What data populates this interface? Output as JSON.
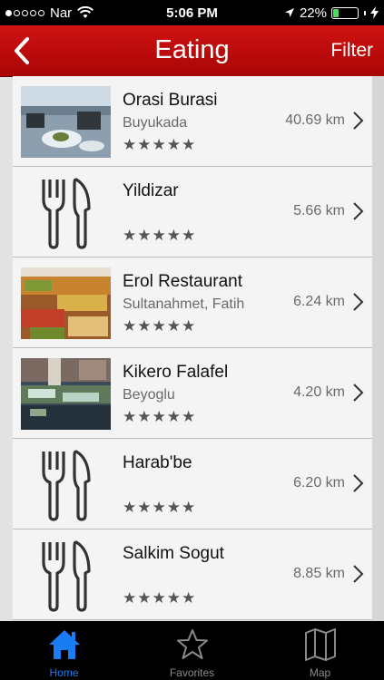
{
  "status_bar": {
    "carrier": "Nar",
    "time": "5:06 PM",
    "battery": "22%",
    "battery_level": 0.22
  },
  "nav": {
    "title": "Eating",
    "filter_label": "Filter",
    "back_icon": "chevron-left-icon"
  },
  "restaurants": [
    {
      "name": "Orasi Burasi",
      "location": "Buyukada",
      "distance": "40.69 km",
      "rating": "★★★★★",
      "image": "photo"
    },
    {
      "name": "Yildizar",
      "location": "",
      "distance": "5.66 km",
      "rating": "★★★★★",
      "image": "cutlery-icon"
    },
    {
      "name": "Erol Restaurant",
      "location": "Sultanahmet, Fatih",
      "distance": "6.24 km",
      "rating": "★★★★★",
      "image": "photo"
    },
    {
      "name": "Kikero Falafel",
      "location": "Beyoglu",
      "distance": "4.20 km",
      "rating": "★★★★★",
      "image": "photo"
    },
    {
      "name": "Harab'be",
      "location": "",
      "distance": "6.20 km",
      "rating": "★★★★★",
      "image": "cutlery-icon"
    },
    {
      "name": "Salkim Sogut",
      "location": "",
      "distance": "8.85 km",
      "rating": "★★★★★",
      "image": "cutlery-icon"
    }
  ],
  "tabs": [
    {
      "label": "Home",
      "icon": "home-icon",
      "active": true
    },
    {
      "label": "Favorites",
      "icon": "star-icon",
      "active": false
    },
    {
      "label": "Map",
      "icon": "map-icon",
      "active": false
    }
  ],
  "colors": {
    "nav_red": "#c40c0c",
    "tab_active": "#1a7cf2",
    "star_gray": "#555555"
  }
}
